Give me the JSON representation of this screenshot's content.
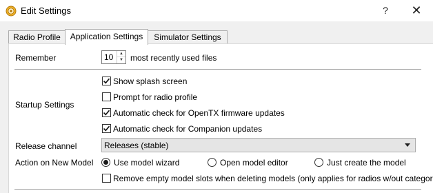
{
  "window": {
    "title": "Edit Settings",
    "help_symbol": "?",
    "close_symbol": "✕",
    "app_icon": "companion-gear-icon",
    "accent": "#e8a317"
  },
  "tabs": [
    {
      "label": "Radio Profile",
      "selected": false
    },
    {
      "label": "Application Settings",
      "selected": true
    },
    {
      "label": "Simulator Settings",
      "selected": false
    }
  ],
  "remember": {
    "label": "Remember",
    "value": "10",
    "suffix": "most recently used files"
  },
  "startup": {
    "label": "Startup Settings",
    "options": [
      {
        "label": "Show splash screen",
        "checked": true
      },
      {
        "label": "Prompt for radio profile",
        "checked": false
      },
      {
        "label": "Automatic check for OpenTX firmware updates",
        "checked": true
      },
      {
        "label": "Automatic check for Companion updates",
        "checked": true
      }
    ]
  },
  "release_channel": {
    "label": "Release channel",
    "value": "Releases (stable)"
  },
  "new_model": {
    "label": "Action on New Model",
    "options": [
      {
        "label": "Use model wizard",
        "selected": true
      },
      {
        "label": "Open model editor",
        "selected": false
      },
      {
        "label": "Just create the model",
        "selected": false
      }
    ],
    "remove_empty": {
      "label": "Remove empty model slots when deleting models (only applies for radios w/out categories)",
      "checked": false
    }
  }
}
